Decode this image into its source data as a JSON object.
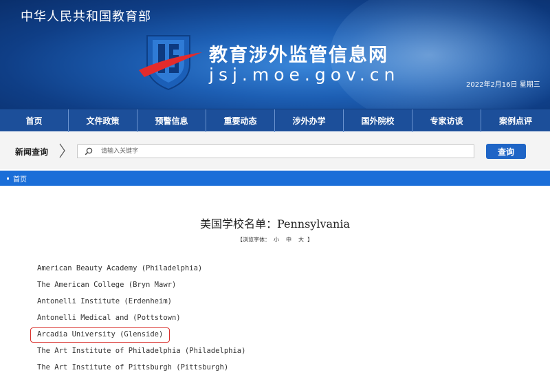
{
  "header": {
    "ministry": "中华人民共和国教育部",
    "site_title": "教育涉外监管信息网",
    "site_domain": "jsj.moe.gov.cn",
    "date": "2022年2月16日  星期三"
  },
  "nav": {
    "items": [
      "首页",
      "文件政策",
      "预警信息",
      "重要动态",
      "涉外办学",
      "国外院校",
      "专家访谈",
      "案例点评"
    ]
  },
  "search": {
    "label": "新闻查询",
    "placeholder": "请输入关键字",
    "button": "查询"
  },
  "breadcrumb": {
    "home": "首页"
  },
  "article": {
    "title": "美国学校名单：Pennsylvania",
    "font_size_label": "【浏览字体：",
    "font_small": "小",
    "font_medium": "中",
    "font_large": "大",
    "font_size_close": "】",
    "schools": [
      "American Beauty Academy (Philadelphia)",
      "The American College (Bryn Mawr)",
      "Antonelli Institute (Erdenheim)",
      "Antonelli Medical and (Pottstown)",
      "Arcadia University (Glenside)",
      "The Art Institute of Philadelphia (Philadelphia)",
      "The Art Institute of Pittsburgh (Pittsburgh)"
    ],
    "highlighted_school": "Arcadia University (Glenside)"
  },
  "colors": {
    "nav_bg": "#1c4f9a",
    "breadcrumb_bg": "#1a6ed8",
    "search_button": "#1f65c6",
    "highlight": "#d9302b"
  },
  "icons": {
    "logo": "jsj-shield-logo",
    "search": "search-icon",
    "arrow": "chevron-right-icon"
  }
}
